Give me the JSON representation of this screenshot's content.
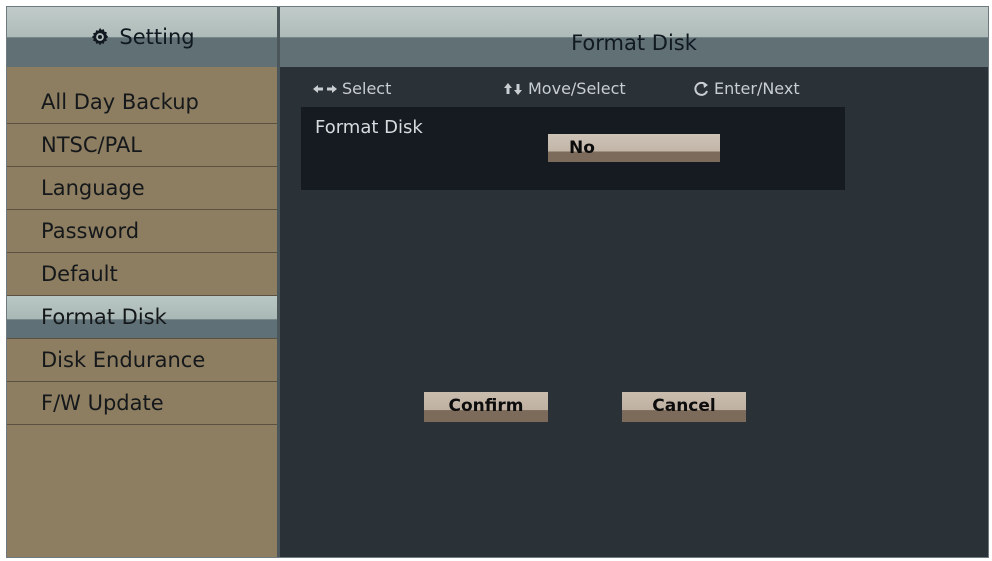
{
  "sidebar": {
    "title": "Setting",
    "title_icon": "gear-icon",
    "items": [
      {
        "label": "All Day Backup"
      },
      {
        "label": "NTSC/PAL"
      },
      {
        "label": "Language"
      },
      {
        "label": "Password"
      },
      {
        "label": "Default"
      },
      {
        "label": "Format Disk",
        "active": true
      },
      {
        "label": "Disk Endurance"
      },
      {
        "label": "F/W Update"
      }
    ]
  },
  "content": {
    "title": "Format Disk",
    "hints": {
      "select": "Select",
      "select_icon": "left-right-arrows-icon",
      "move_select": "Move/Select",
      "move_select_icon": "up-down-arrows-icon",
      "enter_next": "Enter/Next",
      "enter_next_icon": "enter-icon"
    },
    "option": {
      "label": "Format Disk",
      "value": "No"
    },
    "buttons": {
      "confirm": "Confirm",
      "cancel": "Cancel"
    }
  },
  "colors": {
    "sidebar_bg": "#8d7d61",
    "content_bg": "#2a3137",
    "header_bg": "#aebbb8",
    "panel_bg": "#161b21",
    "button_bg": "#c2b6a8"
  }
}
